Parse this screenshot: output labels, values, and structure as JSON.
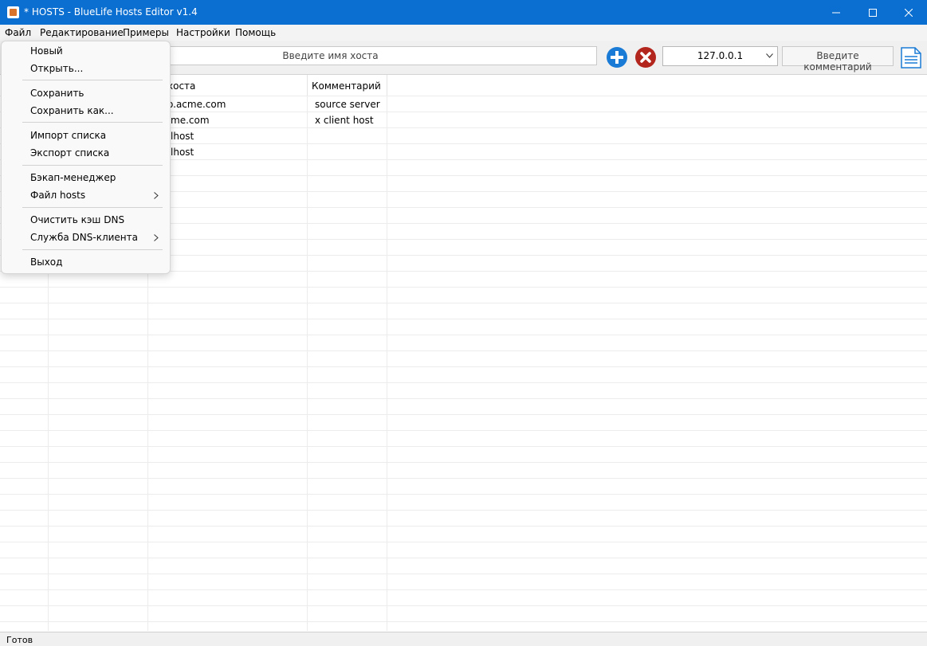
{
  "window": {
    "title": "* HOSTS - BlueLife Hosts Editor v1.4",
    "accent": "#0a6fd1"
  },
  "menubar": {
    "items": [
      "Файл",
      "Редактирование",
      "Примеры",
      "Настройки",
      "Помощь"
    ]
  },
  "toolbar": {
    "hostname_placeholder": "Введите имя хоста",
    "ip_value": "127.0.0.1",
    "comment_placeholder": "Введите комментарий"
  },
  "table": {
    "columns": [
      "хоста",
      "Комментарий"
    ],
    "rows": [
      {
        "host": "o.acme.com",
        "comment": "source server"
      },
      {
        "host": "me.com",
        "comment": "x client host"
      },
      {
        "host": "lhost",
        "comment": ""
      },
      {
        "host": "lhost",
        "comment": ""
      }
    ]
  },
  "file_menu": {
    "items": [
      {
        "label": "Новый"
      },
      {
        "label": "Открыть..."
      },
      {
        "label": "Сохранить"
      },
      {
        "label": "Сохранить как..."
      },
      {
        "label": "Импорт списка"
      },
      {
        "label": "Экспорт списка"
      },
      {
        "label": "Бэкап-менеджер"
      },
      {
        "label": "Файл hosts",
        "submenu": true
      },
      {
        "label": "Очистить кэш DNS"
      },
      {
        "label": "Служба DNS-клиента",
        "submenu": true
      },
      {
        "label": "Выход"
      }
    ]
  },
  "status": {
    "text": "Готов"
  }
}
